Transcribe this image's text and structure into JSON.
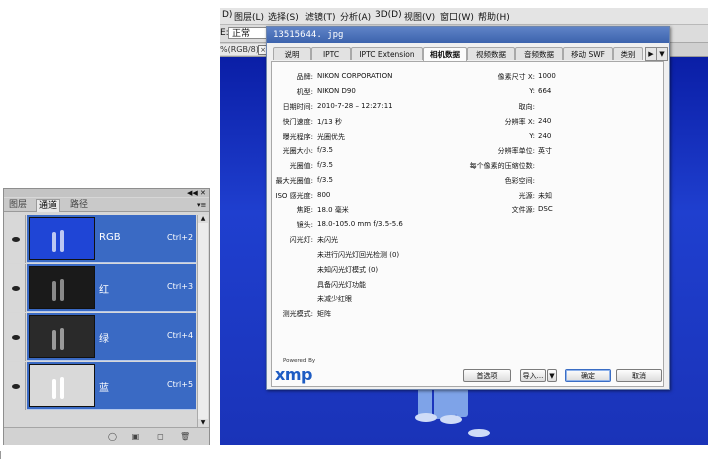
{
  "menubar": {
    "items": [
      "图层(L)",
      "选择(S)",
      "滤镜(T)",
      "分析(A)",
      "3D(D)",
      "视图(V)",
      "窗口(W)",
      "帮助(H)"
    ],
    "leading_mark": "D)"
  },
  "options_bar": {
    "label_prefix": "E:",
    "mode_value": "正常"
  },
  "document_tab": {
    "label": "%(RGB/8)",
    "close": "×"
  },
  "dialog": {
    "title": "13515644. jpg",
    "tabs": [
      "说明",
      "IPTC",
      "IPTC Extension",
      "相机数据",
      "视频数据",
      "音频数据",
      "移动 SWF",
      "类别"
    ],
    "active_tab": "相机数据",
    "tab_next": "▶",
    "tab_menu": "▼",
    "left_fields": [
      {
        "label": "品牌:",
        "value": "NIKON CORPORATION"
      },
      {
        "label": "机型:",
        "value": "NIKON D90"
      },
      {
        "label": "日期时间:",
        "value": "2010-7-28 – 12:27:11"
      },
      {
        "label": "快门速度:",
        "value": "1/13 秒"
      },
      {
        "label": "曝光程序:",
        "value": "光圈优先"
      },
      {
        "label": "光圈大小:",
        "value": "f/3.5"
      },
      {
        "label": "光圈值:",
        "value": "f/3.5"
      },
      {
        "label": "最大光圈值:",
        "value": "f/3.5"
      },
      {
        "label": "ISO 感光度:",
        "value": "800"
      },
      {
        "label": "焦距:",
        "value": "18.0 毫米"
      },
      {
        "label": "镜头:",
        "value": "18.0-105.0 mm f/3.5-5.6"
      },
      {
        "label": "闪光灯:",
        "value": "未闪光"
      }
    ],
    "flash_details": [
      "未进行闪光灯回光检测 (0)",
      "未知闪光灯模式 (0)",
      "具备闪光灯功能",
      "未减少红眼"
    ],
    "metering": {
      "label": "测光模式:",
      "value": "矩阵"
    },
    "right_fields": [
      {
        "label": "像素尺寸 X:",
        "value": "1000"
      },
      {
        "label": "Y:",
        "value": "664"
      },
      {
        "label": "取向:",
        "value": ""
      },
      {
        "label": "分辨率 X:",
        "value": "240"
      },
      {
        "label": "Y:",
        "value": "240"
      },
      {
        "label": "分辨率单位:",
        "value": "英寸"
      },
      {
        "label": "每个像素的压缩位数:",
        "value": ""
      },
      {
        "label": "色彩空间:",
        "value": ""
      },
      {
        "label": "光源:",
        "value": "未知"
      },
      {
        "label": "文件源:",
        "value": "DSC"
      }
    ],
    "xmp_powered": "Powered By",
    "xmp_logo": "xmp",
    "buttons": {
      "preferences": "首选项",
      "import": "导入...",
      "import_arrow": "▼",
      "ok": "确定",
      "cancel": "取消"
    }
  },
  "channels_panel": {
    "collapse": "◀◀",
    "close": "✕",
    "tabs": [
      "图层",
      "通道",
      "路径"
    ],
    "active_tab": "通道",
    "menu": "▾≡",
    "channels": [
      {
        "name": "RGB",
        "shortcut": "Ctrl+2",
        "thumb_color": "#1f45d6"
      },
      {
        "name": "红",
        "shortcut": "Ctrl+3",
        "thumb_color": "#1a1a1a"
      },
      {
        "name": "绿",
        "shortcut": "Ctrl+4",
        "thumb_color": "#2a2a2a"
      },
      {
        "name": "蓝",
        "shortcut": "Ctrl+5",
        "thumb_color": "#d9d9d9"
      }
    ],
    "scroll_up": "▲",
    "scroll_down": "▼",
    "bottom_icons": [
      "◯",
      "▣",
      "◻",
      "🗑"
    ]
  },
  "colors": {
    "canvas_blue": "#1e3fae",
    "selection_blue": "#3a6ac4",
    "title_blue": "#3c63ad",
    "xmp_blue": "#1e5cc3"
  }
}
